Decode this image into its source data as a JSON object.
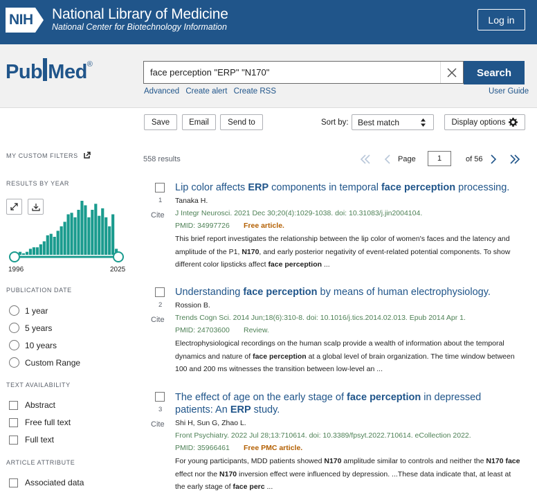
{
  "header": {
    "nih_logo": "NIH",
    "title": "National Library of Medicine",
    "subtitle": "National Center for Biotechnology Information",
    "login_label": "Log in"
  },
  "search": {
    "logo_pre": "Pub",
    "logo_post": "ed",
    "logo_reg": "®",
    "query": "face perception \"ERP\" \"N170\"",
    "button_label": "Search",
    "advanced": "Advanced",
    "create_alert": "Create alert",
    "create_rss": "Create RSS",
    "user_guide": "User Guide"
  },
  "toolbar": {
    "save": "Save",
    "email": "Email",
    "send_to": "Send to",
    "sort_by_label": "Sort by:",
    "sort_value": "Best match",
    "display_options": "Display options"
  },
  "sidebar": {
    "custom_filters": "MY CUSTOM FILTERS",
    "results_by_year": "RESULTS BY YEAR",
    "year_start": "1996",
    "year_end": "2025",
    "publication_date": "PUBLICATION DATE",
    "date_options": [
      "1 year",
      "5 years",
      "10 years",
      "Custom Range"
    ],
    "text_availability": "TEXT AVAILABILITY",
    "text_options": [
      "Abstract",
      "Free full text",
      "Full text"
    ],
    "article_attribute": "ARTICLE ATTRIBUTE",
    "attribute_options": [
      "Associated data"
    ]
  },
  "chart_data": {
    "type": "bar",
    "title": "",
    "categories": [
      "1996",
      "1997",
      "1998",
      "1999",
      "2000",
      "2001",
      "2002",
      "2003",
      "2004",
      "2005",
      "2006",
      "2007",
      "2008",
      "2009",
      "2010",
      "2011",
      "2012",
      "2013",
      "2014",
      "2015",
      "2016",
      "2017",
      "2018",
      "2019",
      "2020",
      "2021",
      "2022",
      "2023",
      "2024",
      "2025"
    ],
    "values": [
      1,
      2,
      1,
      2,
      4,
      5,
      5,
      7,
      9,
      13,
      14,
      12,
      16,
      19,
      22,
      27,
      28,
      25,
      30,
      36,
      33,
      25,
      30,
      34,
      26,
      31,
      25,
      19,
      27,
      4
    ],
    "bar_color": "#1a9b8e"
  },
  "results": {
    "count": "558 results",
    "page_label": "Page",
    "page_value": "1",
    "of_pages": "of 56",
    "cite_label": "Cite",
    "items": [
      {
        "num": "1",
        "title_parts": [
          "Lip color affects ",
          "ERP",
          " components in temporal ",
          "face perception",
          " processing."
        ],
        "authors": "Tanaka H.",
        "journal": "J Integr Neurosci. 2021 Dec 30;20(4):1029-1038. doi: 10.31083/j.jin2004104.",
        "pmid": "PMID: 34997726",
        "badge": "Free article.",
        "snippet_parts": [
          "This brief report investigates the relationship between the lip color of women's faces and the latency and amplitude of the P1, ",
          "N170",
          ", and early posterior negativity of event-related potential components. To show different color lipsticks affect ",
          "face perception",
          " ..."
        ]
      },
      {
        "num": "2",
        "title_parts": [
          "Understanding ",
          "face perception",
          " by means of human electrophysiology."
        ],
        "authors": "Rossion B.",
        "journal": "Trends Cogn Sci. 2014 Jun;18(6):310-8. doi: 10.1016/j.tics.2014.02.013. Epub 2014 Apr 1.",
        "pmid": "PMID: 24703600",
        "badge": "Review.",
        "snippet_parts": [
          "Electrophysiological recordings on the human scalp provide a wealth of information about the temporal dynamics and nature of ",
          "face perception",
          " at a global level of brain organization. The time window between 100 and 200 ms witnesses the transition between low-level an ..."
        ]
      },
      {
        "num": "3",
        "title_parts": [
          "The effect of age on the early stage of ",
          "face perception",
          " in depressed patients: An ",
          "ERP",
          " study."
        ],
        "authors": "Shi H, Sun G, Zhao L.",
        "journal": "Front Psychiatry. 2022 Jul 28;13:710614. doi: 10.3389/fpsyt.2022.710614. eCollection 2022.",
        "pmid": "PMID: 35966461",
        "badge": "Free PMC article.",
        "snippet_parts": [
          "For young participants, MDD patients showed ",
          "N170",
          " amplitude similar to controls and neither the ",
          "N170",
          " ",
          "face",
          " effect nor the ",
          "N170",
          " inversion effect were influenced by depression. ...These data indicate that, at least at the early stage of ",
          "face perc",
          " ..."
        ]
      }
    ]
  }
}
